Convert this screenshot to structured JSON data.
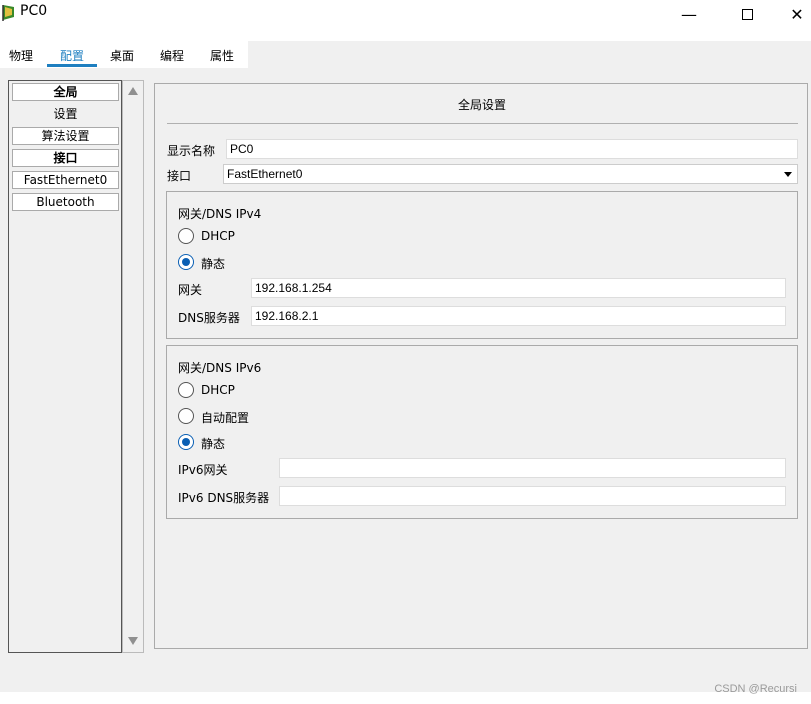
{
  "window": {
    "title": "PC0",
    "minimize_glyph": "—",
    "close_glyph": "✕"
  },
  "tabs": [
    {
      "label": "物理"
    },
    {
      "label": "配置",
      "active": true
    },
    {
      "label": "桌面"
    },
    {
      "label": "编程"
    },
    {
      "label": "属性"
    }
  ],
  "sidebar": {
    "items": [
      {
        "label": "全局"
      },
      {
        "label": "设置"
      },
      {
        "label": "算法设置"
      },
      {
        "label": "接口"
      },
      {
        "label": "FastEthernet0"
      },
      {
        "label": "Bluetooth"
      }
    ]
  },
  "content": {
    "title": "全局设置",
    "display_name_label": "显示名称",
    "display_name_value": "PC0",
    "interface_label": "接口",
    "interface_value": "FastEthernet0",
    "ipv4": {
      "group_title": "网关/DNS IPv4",
      "dhcp_label": "DHCP",
      "static_label": "静态",
      "selected": "static",
      "gateway_label": "网关",
      "gateway_value": "192.168.1.254",
      "dns_label": "DNS服务器",
      "dns_value": "192.168.2.1"
    },
    "ipv6": {
      "group_title": "网关/DNS IPv6",
      "dhcp_label": "DHCP",
      "auto_label": "自动配置",
      "static_label": "静态",
      "selected": "static",
      "gateway_label": "IPv6网关",
      "gateway_value": "",
      "dns_label": "IPv6 DNS服务器",
      "dns_value": ""
    }
  },
  "watermark": "CSDN @Recursi",
  "colors": {
    "accent": "#1e7fc0",
    "radio_selected": "#0a5fb4",
    "panel_bg": "#f0f0f0"
  }
}
